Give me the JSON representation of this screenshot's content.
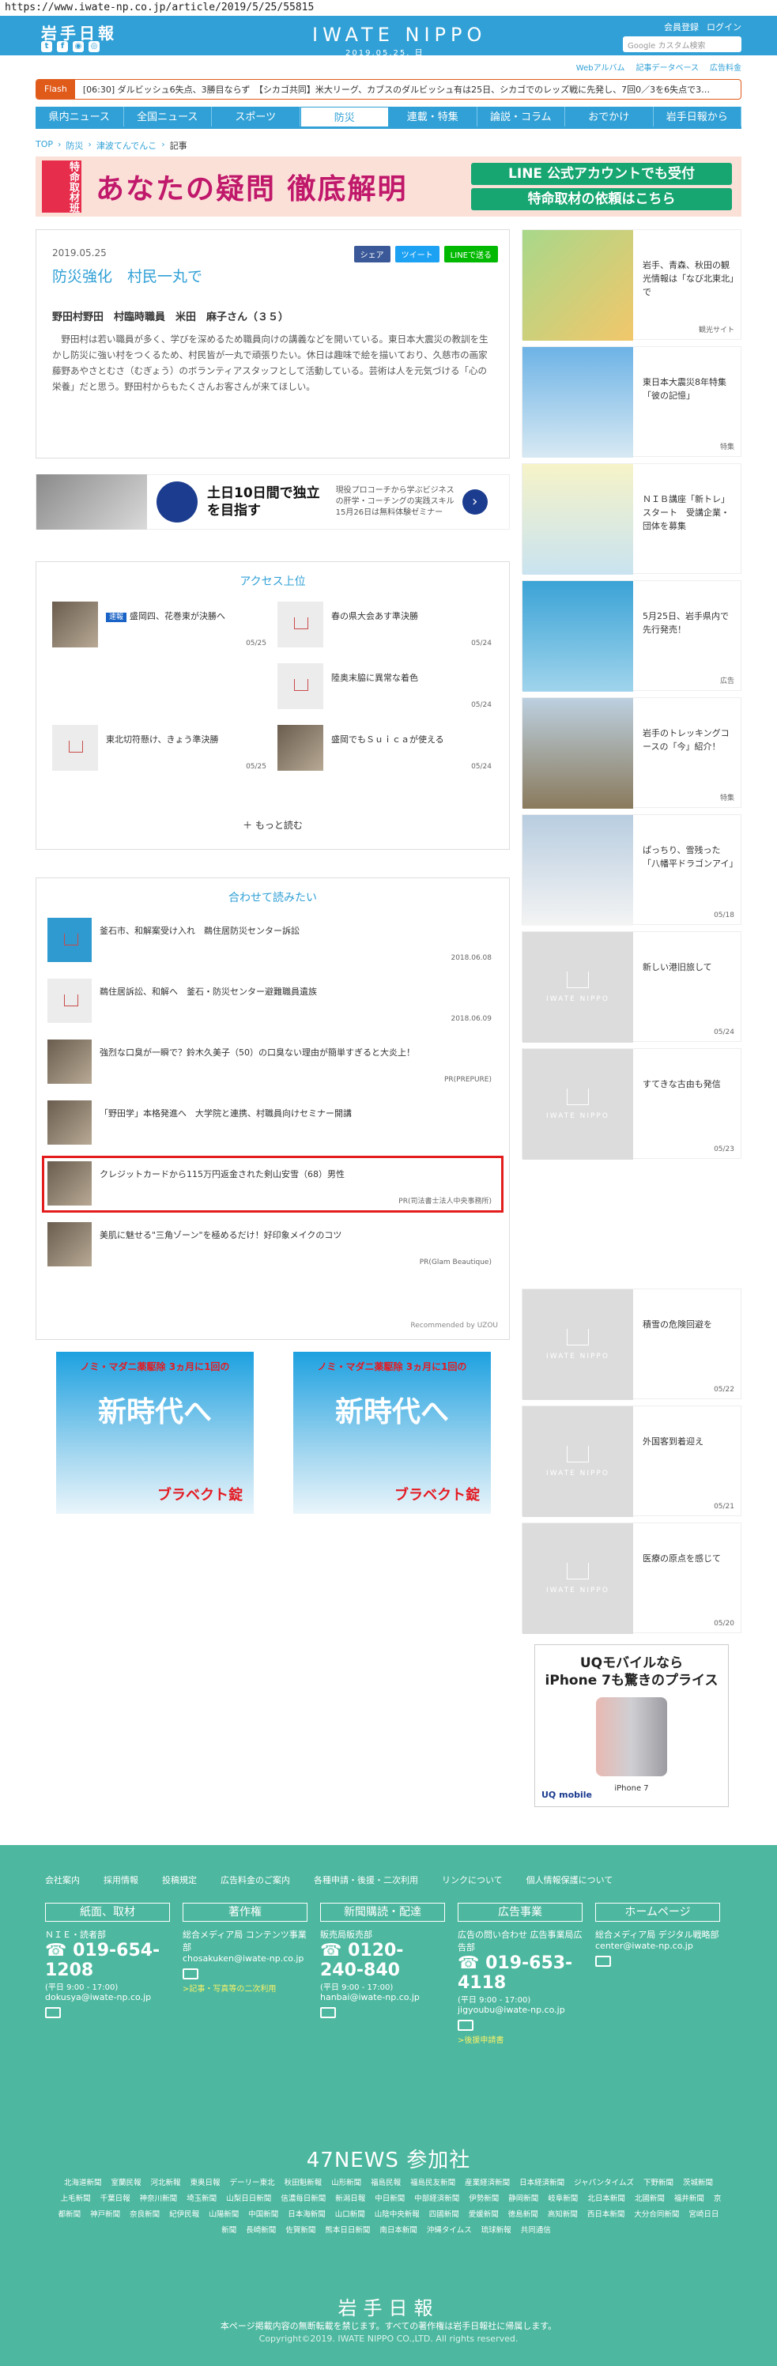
{
  "url": "https://www.iwate-np.co.jp/article/2019/5/25/55815",
  "header": {
    "logo_jp": "岩手日報",
    "logo_en": "IWATE NIPPO",
    "date": "2019.05.25. 日",
    "member_register": "会員登録",
    "login": "ログイン",
    "search_placeholder": "Google カスタム検索",
    "social_icons": [
      "twitter-icon",
      "facebook-icon",
      "rss-icon",
      "instagram-icon"
    ]
  },
  "subnav": [
    "Webアルバム",
    "記事データベース",
    "広告料金"
  ],
  "flash": {
    "tag": "Flash",
    "text": "[06:30] ダルビッシュ6失点、3勝目ならず　【シカゴ共同】米大リーグ、カブスのダルビッシュ有は25日、シカゴでのレッズ戦に先発し、7回0／3を6失点で3…"
  },
  "gnav": [
    "県内ニュース",
    "全国ニュース",
    "スポーツ",
    "防災",
    "連載・特集",
    "論説・コラム",
    "おでかけ",
    "岩手日報から"
  ],
  "breadcrumb": [
    "TOP",
    "防災",
    "津波てんでんこ",
    "記事"
  ],
  "banner": {
    "badge": "特命取材班",
    "title": "あなたの疑問 徹底解明",
    "line1": "LINE 公式アカウントでも受付",
    "line2": "特命取材の依頼はこちら"
  },
  "article": {
    "date": "2019.05.25",
    "title": "防災強化　村民一丸で",
    "share": [
      "シェア",
      "ツイート",
      "LINEで送る"
    ],
    "subtitle": "野田村野田　村臨時職員　米田　麻子さん（３５）",
    "body": "野田村は若い職員が多く、学びを深めるため職員向けの講義などを開いている。東日本大震災の教訓を生かし防災に強い村をつくるため、村民皆が一丸で頑張りたい。休日は趣味で絵を描いており、久慈市の画家藤野あやさとむさ（むぎょう）のボランティアスタッフとして活動している。芸術は人を元気づける「心の栄養」だと思う。野田村からもたくさんお客さんが来てほしい。"
  },
  "ad_strip": {
    "headline1": "土日10日間で独立",
    "headline2": "を目指す",
    "desc": "現役プロコーチから学ぶビジネスの肝学・コーチングの実践スキル15月26日は無料体験ゼミナー"
  },
  "ranking": {
    "title": "アクセス上位",
    "items": [
      {
        "tag": "速報",
        "text": "盛岡四、花巻東が決勝へ",
        "date": "05/25"
      },
      {
        "tag": "",
        "text": "春の県大会あす準決勝",
        "date": "05/24"
      },
      {
        "tag": "",
        "text": "陸奥末脇に異常な着色",
        "date": "05/24"
      },
      {
        "tag": "",
        "text": "東北切符懸け、きょう準決勝",
        "date": "05/25"
      },
      {
        "tag": "",
        "text": "盛岡でもＳｕｉｃａが使える",
        "date": "05/24"
      }
    ],
    "more": "もっと読む"
  },
  "related": {
    "title": "合わせて読みたい",
    "items": [
      {
        "text": "釜石市、和解案受け入れ　鵜住居防災センター訴訟",
        "meta": "2018.06.08"
      },
      {
        "text": "鵜住居訴訟、和解へ　釜石・防災センター避難職員遺族",
        "meta": "2018.06.09"
      },
      {
        "text": "強烈な口臭が一瞬で？鈴木久美子（50）の口臭ない理由が簡単すぎると大炎上！",
        "meta": "PR(PREPURE)"
      },
      {
        "text": "「野田学」本格発進へ　大学院と連携、村職員向けセミナー開講",
        "meta": ""
      },
      {
        "text": "クレジットカードから115万円返金された剣山安雪（68）男性",
        "meta": "PR(司法書士法人中央事務所)"
      },
      {
        "text": "美肌に魅せる\"三角ゾーン\"を極めるだけ！好印象メイクのコツ",
        "meta": "PR(Glam Beautique)"
      }
    ],
    "recommended": "Recommended by UZOU"
  },
  "promo_ad": {
    "line1": "ノミ・マダニ薬駆除 3ヵ月に1回の",
    "line2": "新時代へ",
    "brand": "ブラベクト錠"
  },
  "side": [
    {
      "text": "岩手、青森、秋田の観光情報は「なび北東北」で",
      "meta": "観光サイト"
    },
    {
      "text": "東日本大震災8年特集「彼の記憶」",
      "meta": "特集"
    },
    {
      "text": "ＮＩＢ講座「新トレ」スタート　受講企業・団体を募集",
      "meta": ""
    },
    {
      "text": "5月25日、岩手県内で先行発売！",
      "meta": "広告"
    },
    {
      "text": "岩手のトレッキングコースの「今」紹介！",
      "meta": "特集"
    },
    {
      "text": "ぱっちり、雪残った「八幡平ドラゴンアイ」",
      "meta": "05/18"
    },
    {
      "text": "新しい港旧旅して",
      "meta": "05/24"
    },
    {
      "text": "すてきな古由も発信",
      "meta": "05/23"
    },
    {
      "text": "積雪の危険回避を",
      "meta": "05/22"
    },
    {
      "text": "外国客到着迎え",
      "meta": "05/21"
    },
    {
      "text": "医療の原点を感じて",
      "meta": "05/20"
    }
  ],
  "uq_ad": {
    "line1": "UQモバイルなら",
    "line2": "iPhone 7も驚きのプライス",
    "brand": "UQ mobile",
    "model": "iPhone 7"
  },
  "footer": {
    "links": [
      "会社案内",
      "採用情報",
      "投稿規定",
      "広告料金のご案内",
      "各種申請・後援・二次利用",
      "リンクについて",
      "個人情報保護について"
    ],
    "cols": [
      {
        "head": "紙面、取材",
        "dept": "ＮＩＥ・読者部",
        "tel": "019-654-1208",
        "hours": "(平日 9:00 - 17:00)",
        "mail": "dokusya@iwate-np.co.jp",
        "extra": ""
      },
      {
        "head": "著作権",
        "dept": "総合メディア局 コンテンツ事業部",
        "tel": "",
        "hours": "",
        "mail": "chosakuken@iwate-np.co.jp",
        "extra": ">記事・写真等の二次利用"
      },
      {
        "head": "新聞購読・配達",
        "dept": "販売局販売部",
        "tel": "0120-240-840",
        "hours": "(平日 9:00 - 17:00)",
        "mail": "hanbai@iwate-np.co.jp",
        "extra": ""
      },
      {
        "head": "広告事業",
        "dept": "広告の問い合わせ 広告事業局広告部",
        "tel": "019-653-4118",
        "hours": "(平日 9:00 - 17:00)",
        "mail": "jigyoubu@iwate-np.co.jp",
        "extra": ">後援申請書"
      },
      {
        "head": "ホームページ",
        "dept": "総合メディア局 デジタル戦略部",
        "tel": "",
        "hours": "",
        "mail": "center@iwate-np.co.jp",
        "extra": ""
      }
    ],
    "news47": "47NEWS 参加社",
    "papers": [
      "北海道新聞",
      "室蘭民報",
      "河北新報",
      "東奥日報",
      "デーリー東北",
      "秋田魁新報",
      "山形新聞",
      "福島民報",
      "福島民友新聞",
      "産業経済新聞",
      "日本経済新聞",
      "ジャパンタイムズ",
      "下野新聞",
      "茨城新聞",
      "上毛新聞",
      "千葉日報",
      "神奈川新聞",
      "埼玉新聞",
      "山梨日日新聞",
      "信濃毎日新聞",
      "新潟日報",
      "中日新聞",
      "中部経済新聞",
      "伊勢新聞",
      "静岡新聞",
      "岐阜新聞",
      "北日本新聞",
      "北國新聞",
      "福井新聞",
      "京都新聞",
      "神戸新聞",
      "奈良新聞",
      "紀伊民報",
      "山陽新聞",
      "中国新聞",
      "日本海新聞",
      "山口新聞",
      "山陰中央新報",
      "四國新聞",
      "愛媛新聞",
      "徳島新聞",
      "高知新聞",
      "西日本新聞",
      "大分合同新聞",
      "宮崎日日新聞",
      "長崎新聞",
      "佐賀新聞",
      "熊本日日新聞",
      "南日本新聞",
      "沖縄タイムス",
      "琉球新報",
      "共同通信"
    ],
    "logo": "岩手日報",
    "note": "本ページ掲載内容の無断転載を禁じます。すべての著作権は岩手日報社に帰属します。",
    "copyright": "Copyright©2019. IWATE NIPPO CO.,LTD. All rights reserved."
  }
}
